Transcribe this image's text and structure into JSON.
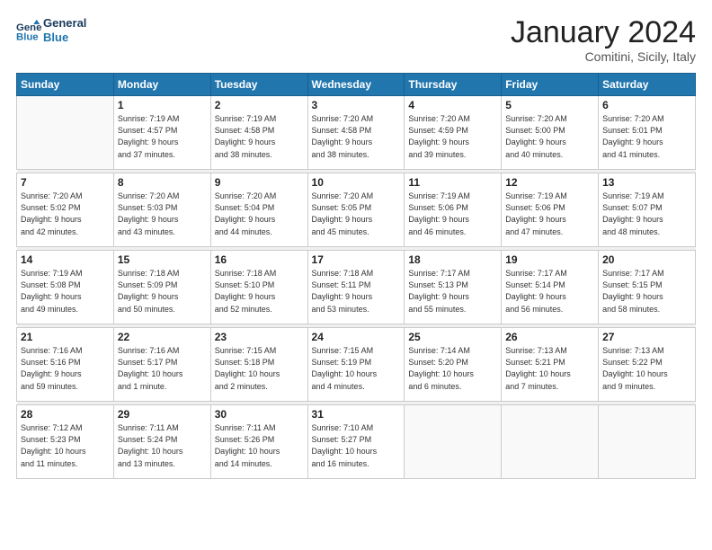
{
  "logo": {
    "line1": "General",
    "line2": "Blue"
  },
  "title": "January 2024",
  "subtitle": "Comitini, Sicily, Italy",
  "headers": [
    "Sunday",
    "Monday",
    "Tuesday",
    "Wednesday",
    "Thursday",
    "Friday",
    "Saturday"
  ],
  "weeks": [
    [
      {
        "day": "",
        "info": ""
      },
      {
        "day": "1",
        "info": "Sunrise: 7:19 AM\nSunset: 4:57 PM\nDaylight: 9 hours\nand 37 minutes."
      },
      {
        "day": "2",
        "info": "Sunrise: 7:19 AM\nSunset: 4:58 PM\nDaylight: 9 hours\nand 38 minutes."
      },
      {
        "day": "3",
        "info": "Sunrise: 7:20 AM\nSunset: 4:58 PM\nDaylight: 9 hours\nand 38 minutes."
      },
      {
        "day": "4",
        "info": "Sunrise: 7:20 AM\nSunset: 4:59 PM\nDaylight: 9 hours\nand 39 minutes."
      },
      {
        "day": "5",
        "info": "Sunrise: 7:20 AM\nSunset: 5:00 PM\nDaylight: 9 hours\nand 40 minutes."
      },
      {
        "day": "6",
        "info": "Sunrise: 7:20 AM\nSunset: 5:01 PM\nDaylight: 9 hours\nand 41 minutes."
      }
    ],
    [
      {
        "day": "7",
        "info": "Sunrise: 7:20 AM\nSunset: 5:02 PM\nDaylight: 9 hours\nand 42 minutes."
      },
      {
        "day": "8",
        "info": "Sunrise: 7:20 AM\nSunset: 5:03 PM\nDaylight: 9 hours\nand 43 minutes."
      },
      {
        "day": "9",
        "info": "Sunrise: 7:20 AM\nSunset: 5:04 PM\nDaylight: 9 hours\nand 44 minutes."
      },
      {
        "day": "10",
        "info": "Sunrise: 7:20 AM\nSunset: 5:05 PM\nDaylight: 9 hours\nand 45 minutes."
      },
      {
        "day": "11",
        "info": "Sunrise: 7:19 AM\nSunset: 5:06 PM\nDaylight: 9 hours\nand 46 minutes."
      },
      {
        "day": "12",
        "info": "Sunrise: 7:19 AM\nSunset: 5:06 PM\nDaylight: 9 hours\nand 47 minutes."
      },
      {
        "day": "13",
        "info": "Sunrise: 7:19 AM\nSunset: 5:07 PM\nDaylight: 9 hours\nand 48 minutes."
      }
    ],
    [
      {
        "day": "14",
        "info": "Sunrise: 7:19 AM\nSunset: 5:08 PM\nDaylight: 9 hours\nand 49 minutes."
      },
      {
        "day": "15",
        "info": "Sunrise: 7:18 AM\nSunset: 5:09 PM\nDaylight: 9 hours\nand 50 minutes."
      },
      {
        "day": "16",
        "info": "Sunrise: 7:18 AM\nSunset: 5:10 PM\nDaylight: 9 hours\nand 52 minutes."
      },
      {
        "day": "17",
        "info": "Sunrise: 7:18 AM\nSunset: 5:11 PM\nDaylight: 9 hours\nand 53 minutes."
      },
      {
        "day": "18",
        "info": "Sunrise: 7:17 AM\nSunset: 5:13 PM\nDaylight: 9 hours\nand 55 minutes."
      },
      {
        "day": "19",
        "info": "Sunrise: 7:17 AM\nSunset: 5:14 PM\nDaylight: 9 hours\nand 56 minutes."
      },
      {
        "day": "20",
        "info": "Sunrise: 7:17 AM\nSunset: 5:15 PM\nDaylight: 9 hours\nand 58 minutes."
      }
    ],
    [
      {
        "day": "21",
        "info": "Sunrise: 7:16 AM\nSunset: 5:16 PM\nDaylight: 9 hours\nand 59 minutes."
      },
      {
        "day": "22",
        "info": "Sunrise: 7:16 AM\nSunset: 5:17 PM\nDaylight: 10 hours\nand 1 minute."
      },
      {
        "day": "23",
        "info": "Sunrise: 7:15 AM\nSunset: 5:18 PM\nDaylight: 10 hours\nand 2 minutes."
      },
      {
        "day": "24",
        "info": "Sunrise: 7:15 AM\nSunset: 5:19 PM\nDaylight: 10 hours\nand 4 minutes."
      },
      {
        "day": "25",
        "info": "Sunrise: 7:14 AM\nSunset: 5:20 PM\nDaylight: 10 hours\nand 6 minutes."
      },
      {
        "day": "26",
        "info": "Sunrise: 7:13 AM\nSunset: 5:21 PM\nDaylight: 10 hours\nand 7 minutes."
      },
      {
        "day": "27",
        "info": "Sunrise: 7:13 AM\nSunset: 5:22 PM\nDaylight: 10 hours\nand 9 minutes."
      }
    ],
    [
      {
        "day": "28",
        "info": "Sunrise: 7:12 AM\nSunset: 5:23 PM\nDaylight: 10 hours\nand 11 minutes."
      },
      {
        "day": "29",
        "info": "Sunrise: 7:11 AM\nSunset: 5:24 PM\nDaylight: 10 hours\nand 13 minutes."
      },
      {
        "day": "30",
        "info": "Sunrise: 7:11 AM\nSunset: 5:26 PM\nDaylight: 10 hours\nand 14 minutes."
      },
      {
        "day": "31",
        "info": "Sunrise: 7:10 AM\nSunset: 5:27 PM\nDaylight: 10 hours\nand 16 minutes."
      },
      {
        "day": "",
        "info": ""
      },
      {
        "day": "",
        "info": ""
      },
      {
        "day": "",
        "info": ""
      }
    ]
  ]
}
